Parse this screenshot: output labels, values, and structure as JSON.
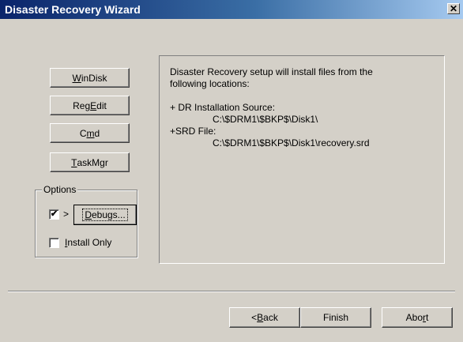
{
  "window": {
    "title": "Disaster Recovery Wizard",
    "close_glyph": "✕"
  },
  "tools": {
    "windisk_pre": "",
    "windisk_u": "W",
    "windisk_post": "inDisk",
    "regedit_pre": "Reg",
    "regedit_u": "E",
    "regedit_post": "dit",
    "cmd_pre": "C",
    "cmd_u": "m",
    "cmd_post": "d",
    "taskmgr_pre": "",
    "taskmgr_u": "T",
    "taskmgr_post": "askMgr"
  },
  "options": {
    "group_label": "Options",
    "debug_checked_glyph": "✔",
    "arrow": ">",
    "debugs_u": "D",
    "debugs_post": "ebugs...",
    "install_only_u": "I",
    "install_only_post": "nstall Only"
  },
  "info": {
    "line1": "Disaster Recovery setup will install files from the",
    "line2": "following locations:",
    "line3": "+ DR Installation Source:",
    "line4": "C:\\$DRM1\\$BKP$\\Disk1\\",
    "line5": "+SRD File:",
    "line6": "C:\\$DRM1\\$BKP$\\Disk1\\recovery.srd"
  },
  "footer": {
    "back_pre": "< ",
    "back_u": "B",
    "back_post": "ack",
    "finish": "Finish",
    "abort_pre": "Abo",
    "abort_u": "r",
    "abort_post": "t"
  },
  "colors": {
    "titlebar_start": "#0a246a",
    "titlebar_end": "#a6caf0",
    "face": "#d4d0c8"
  }
}
